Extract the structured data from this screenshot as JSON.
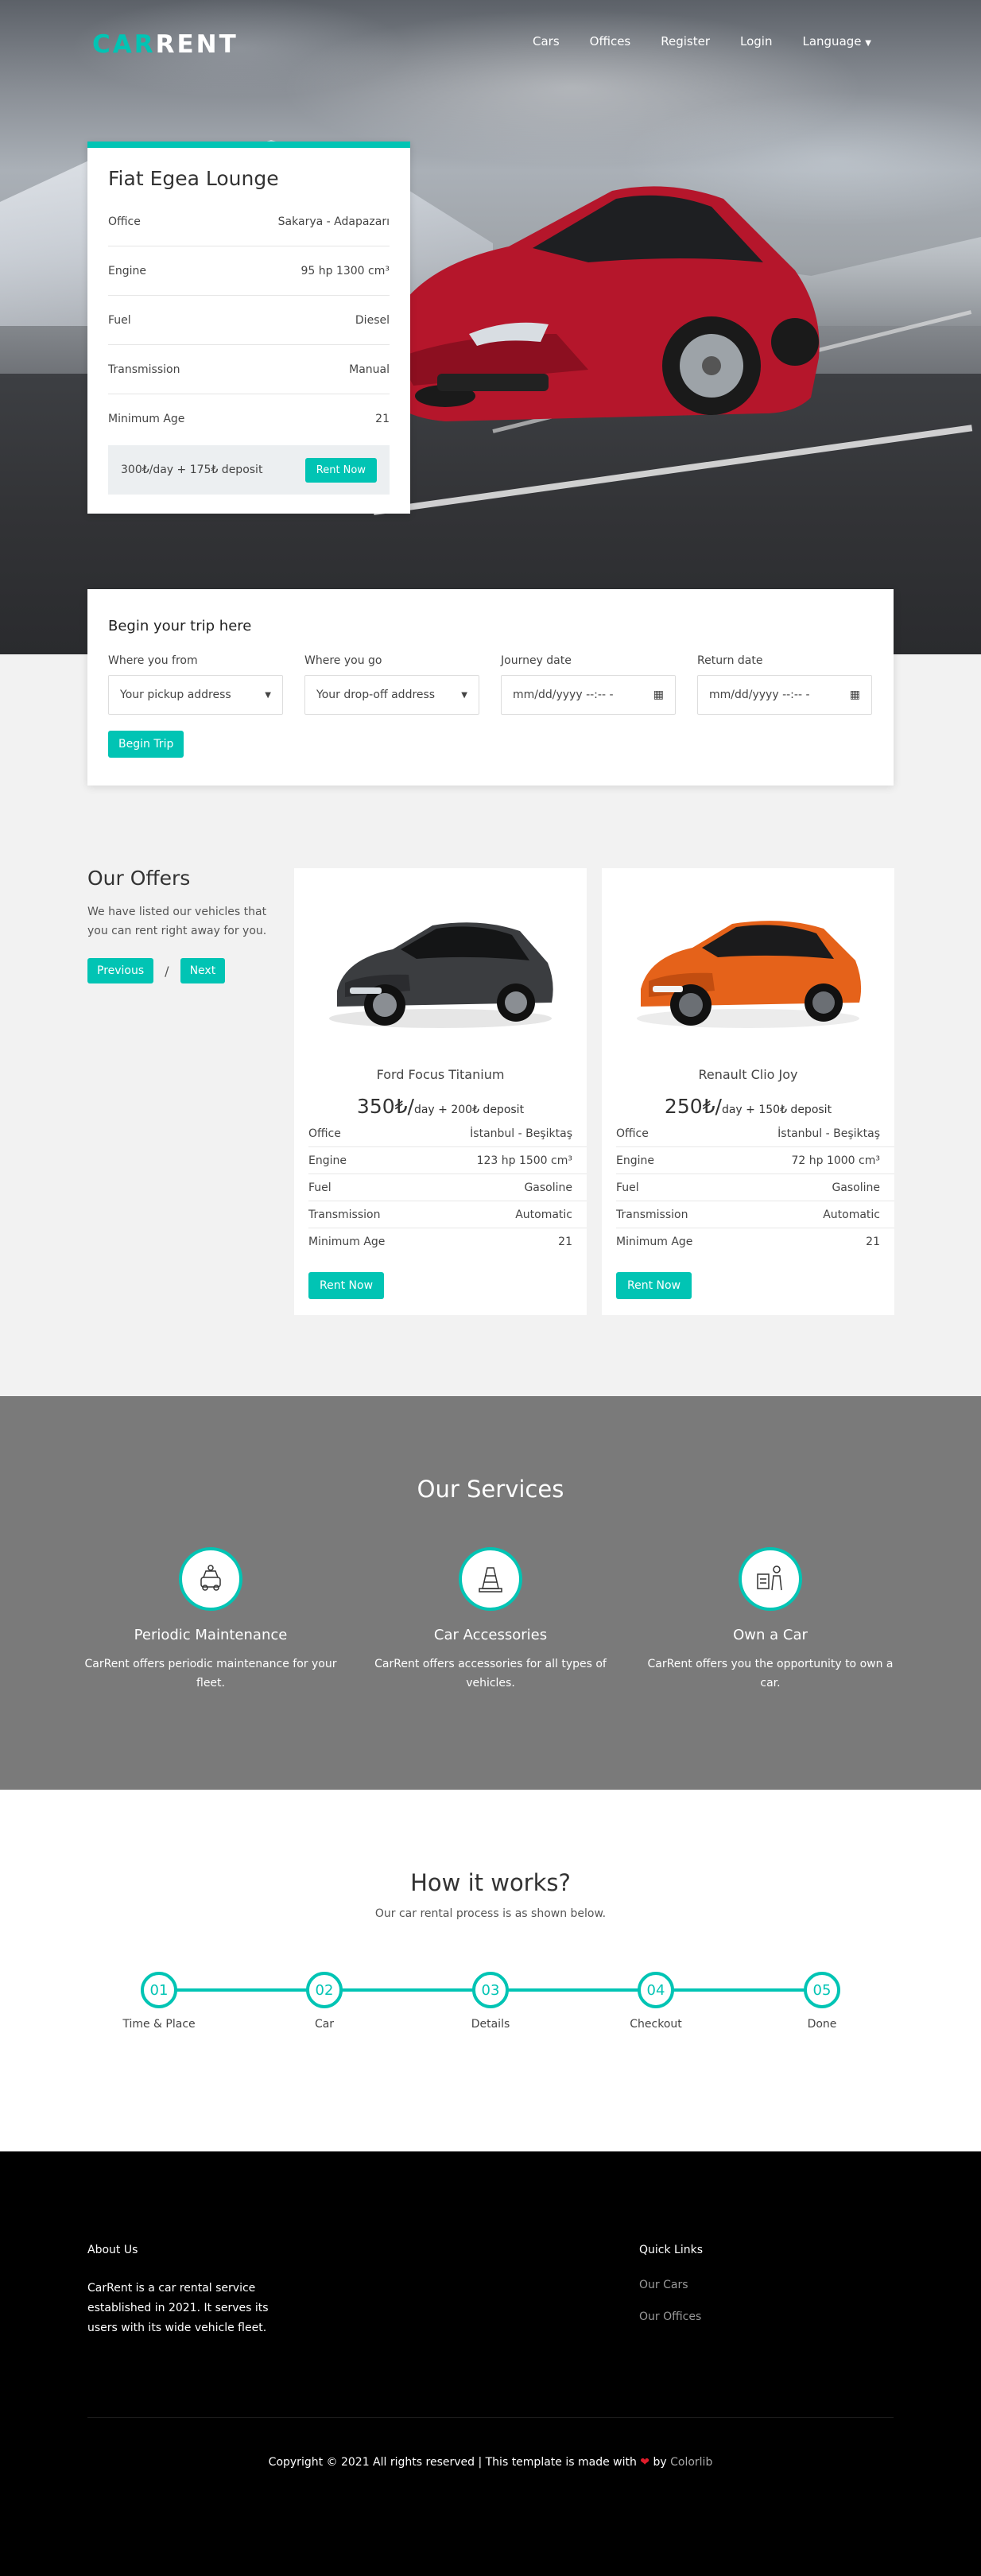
{
  "brand": {
    "logo_part1": "CAR",
    "logo_part2": "RENT",
    "accent": "#01c4b4"
  },
  "nav": {
    "items": [
      "Cars",
      "Offices",
      "Register",
      "Login",
      "Language"
    ]
  },
  "featured": {
    "title": "Fiat Egea Lounge",
    "specs": [
      {
        "label": "Office",
        "value": "Sakarya - Adapazarı"
      },
      {
        "label": "Engine",
        "value": "95 hp 1300 cm³"
      },
      {
        "label": "Fuel",
        "value": "Diesel"
      },
      {
        "label": "Transmission",
        "value": "Manual"
      },
      {
        "label": "Minimum Age",
        "value": "21"
      }
    ],
    "price_text": "300₺/day + 175₺ deposit",
    "rent_label": "Rent Now"
  },
  "search": {
    "title": "Begin your trip here",
    "fields": [
      {
        "label": "Where you from",
        "value": "Your pickup address"
      },
      {
        "label": "Where you go",
        "value": "Your drop-off address"
      },
      {
        "label": "Journey date",
        "value": "mm/dd/yyyy --:-- -"
      },
      {
        "label": "Return date",
        "value": "mm/dd/yyyy --:-- -"
      }
    ],
    "button": "Begin Trip"
  },
  "offers": {
    "title": "Our Offers",
    "description": "We have listed our vehicles that you can rent right away for you.",
    "prev": "Previous",
    "sep": "/",
    "next": "Next",
    "cars": [
      {
        "name": "Ford Focus Titanium",
        "price_big": "350₺/",
        "price_small": "day + 200₺ deposit",
        "color": "#3b3d40",
        "specs": [
          {
            "label": "Office",
            "value": "İstanbul - Beşiktaş"
          },
          {
            "label": "Engine",
            "value": "123 hp 1500 cm³"
          },
          {
            "label": "Fuel",
            "value": "Gasoline"
          },
          {
            "label": "Transmission",
            "value": "Automatic"
          },
          {
            "label": "Minimum Age",
            "value": "21"
          }
        ],
        "button": "Rent Now"
      },
      {
        "name": "Renault Clio Joy",
        "price_big": "250₺/",
        "price_small": "day + 150₺ deposit",
        "color": "#e5621a",
        "specs": [
          {
            "label": "Office",
            "value": "İstanbul - Beşiktaş"
          },
          {
            "label": "Engine",
            "value": "72 hp 1000 cm³"
          },
          {
            "label": "Fuel",
            "value": "Gasoline"
          },
          {
            "label": "Transmission",
            "value": "Automatic"
          },
          {
            "label": "Minimum Age",
            "value": "21"
          }
        ],
        "button": "Rent Now"
      }
    ]
  },
  "services": {
    "title": "Our Services",
    "items": [
      {
        "title": "Periodic Maintenance",
        "text": "CarRent offers periodic maintenance for your fleet.",
        "icon": "car-maintenance-icon"
      },
      {
        "title": "Car Accessories",
        "text": "CarRent offers accessories for all types of vehicles.",
        "icon": "traffic-cone-icon"
      },
      {
        "title": "Own a Car",
        "text": "CarRent offers you the opportunity to own a car.",
        "icon": "person-car-icon"
      }
    ]
  },
  "how": {
    "title": "How it works?",
    "subtitle": "Our car rental process is as shown below.",
    "steps": [
      {
        "num": "01",
        "label": "Time & Place"
      },
      {
        "num": "02",
        "label": "Car"
      },
      {
        "num": "03",
        "label": "Details"
      },
      {
        "num": "04",
        "label": "Checkout"
      },
      {
        "num": "05",
        "label": "Done"
      }
    ]
  },
  "footer": {
    "about_title": "About Us",
    "about_text": "CarRent is a car rental service established in 2021. It serves its users with its wide vehicle fleet.",
    "links_title": "Quick Links",
    "links": [
      "Our Cars",
      "Our Offices"
    ],
    "copyright": "Copyright © 2021 All rights reserved | This template is made with",
    "heart": "❤",
    "by": "by",
    "credit": "Colorlib"
  }
}
